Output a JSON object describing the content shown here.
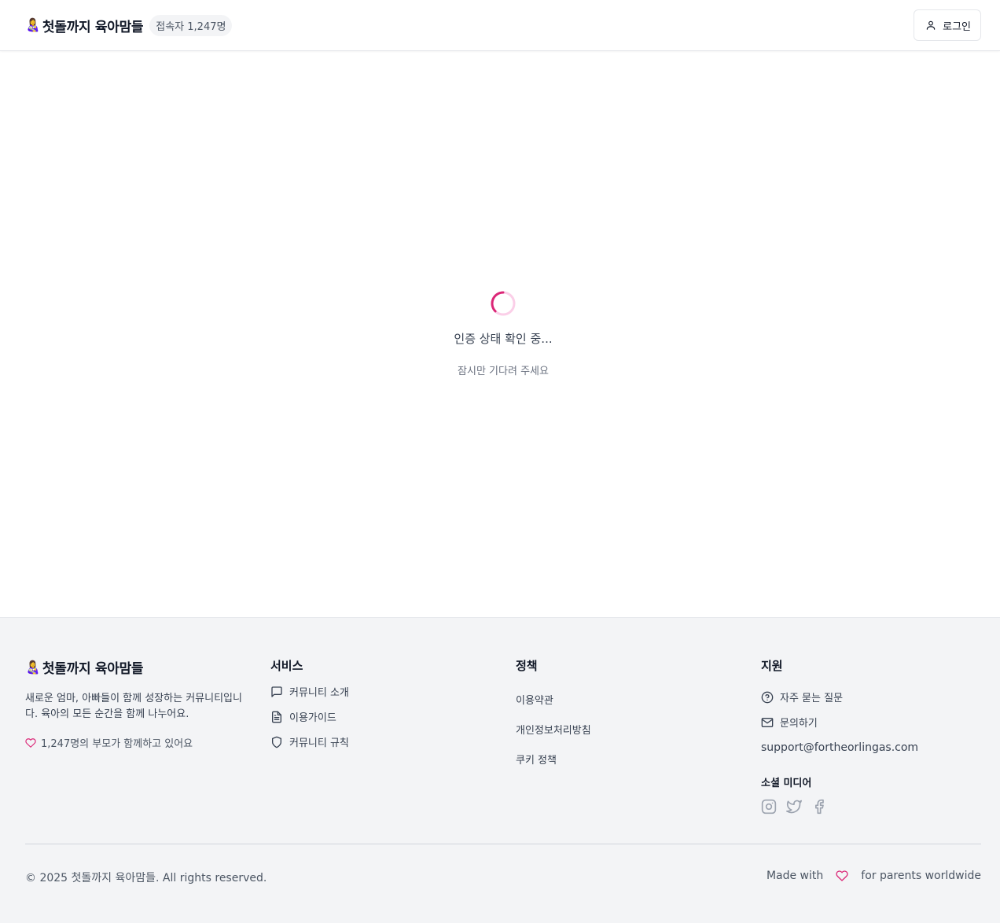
{
  "header": {
    "brand_emoji": "👩‍🍼",
    "brand_name": "첫돌까지 육아맘들",
    "visitor_badge": "접속자 1,247명",
    "login_label": "로그인"
  },
  "loading": {
    "title": "인증 상태 확인 중...",
    "subtitle": "잠시만 기다려 주세요",
    "spinner_color": "#e11d74"
  },
  "footer": {
    "brand_emoji": "👩‍🍼",
    "brand_name": "첫돌까지 육아맘들",
    "description": "새로운 엄마, 아빠들이 함께 성장하는 커뮤니티입니다. 육아의 모든 순간을 함께 나누어요.",
    "parents_count_text": "1,247명의 부모가 함께하고 있어요",
    "services": {
      "title": "서비스",
      "items": [
        {
          "label": "커뮤니티 소개",
          "icon": "message-square-icon"
        },
        {
          "label": "이용가이드",
          "icon": "file-text-icon"
        },
        {
          "label": "커뮤니티 규칙",
          "icon": "shield-icon"
        }
      ]
    },
    "policy": {
      "title": "정책",
      "items": [
        {
          "label": "이용약관"
        },
        {
          "label": "개인정보처리방침"
        },
        {
          "label": "쿠키 정책"
        }
      ]
    },
    "support": {
      "title": "지원",
      "items": [
        {
          "label": "자주 묻는 질문",
          "icon": "help-circle-icon"
        },
        {
          "label": "문의하기",
          "icon": "mail-icon"
        }
      ],
      "email": "support@fortheorlingas.com",
      "social_title": "소셜 미디어",
      "social_icons": [
        "instagram-icon",
        "twitter-icon",
        "facebook-icon"
      ]
    },
    "copyright": "© 2025 첫돌까지 육아맘들. All rights reserved.",
    "made_with_prefix": "Made with",
    "made_with_suffix": "for parents worldwide",
    "accent_color": "#db2777"
  }
}
